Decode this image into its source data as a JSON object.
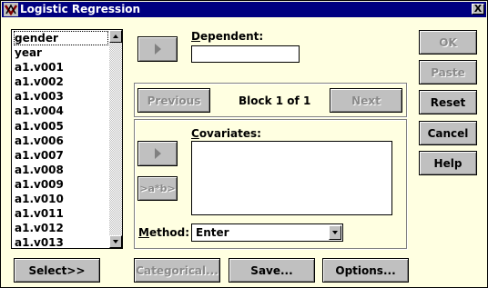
{
  "window": {
    "title": "Logistic Regression",
    "close_label": "X"
  },
  "variables": [
    "gender",
    "year",
    "a1.v001",
    "a1.v002",
    "a1.v003",
    "a1.v004",
    "a1.v005",
    "a1.v006",
    "a1.v007",
    "a1.v008",
    "a1.v009",
    "a1.v010",
    "a1.v011",
    "a1.v012",
    "a1.v013"
  ],
  "dependent": {
    "label": "Dependent:",
    "value": ""
  },
  "block": {
    "previous": "Previous",
    "status": "Block 1 of 1",
    "next": "Next"
  },
  "covariates": {
    "label": "Covariates:",
    "interaction_button": ">a*b>"
  },
  "method": {
    "label": "Method:",
    "value": "Enter"
  },
  "side_buttons": {
    "ok": "OK",
    "paste": "Paste",
    "reset": "Reset",
    "cancel": "Cancel",
    "help": "Help"
  },
  "bottom_buttons": {
    "select": "Select>>",
    "categorical": "Categorical...",
    "save": "Save...",
    "options": "Options..."
  },
  "colors": {
    "dialog_bg": "#ffffe1",
    "titlebar": "#000080",
    "button_face": "#c0c0c0"
  }
}
